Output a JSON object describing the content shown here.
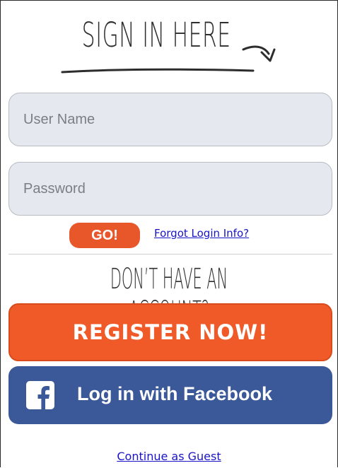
{
  "signin": {
    "heading": "SIGN IN HERE",
    "username_placeholder": "User Name",
    "password_placeholder": "Password",
    "go_label": "GO!",
    "forgot_label": "Forgot Login Info?"
  },
  "signup": {
    "heading": "DON’T HAVE AN ACCOUNT?",
    "register_label": "REGISTER NOW!",
    "facebook_label": "Log in with Facebook",
    "guest_label": "Continue as Guest"
  },
  "icons": {
    "heading_arrow": "curved-arrow-icon",
    "facebook": "facebook-icon"
  },
  "colors": {
    "accent_orange": "#ef5a28",
    "facebook_blue": "#3b5998",
    "link_blue": "#1a14c8",
    "field_bg": "#e5e8ee"
  }
}
